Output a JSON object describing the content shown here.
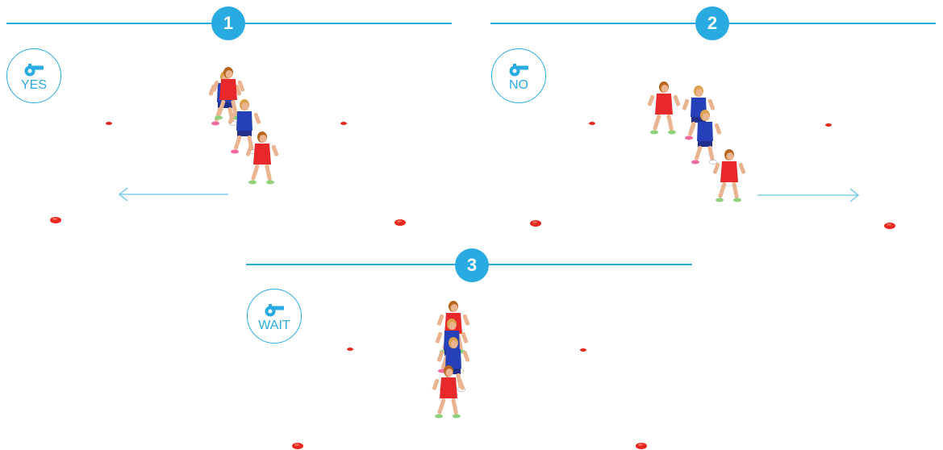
{
  "steps": [
    {
      "number": "1",
      "call": "YES"
    },
    {
      "number": "2",
      "call": "NO"
    },
    {
      "number": "3",
      "call": "WAIT"
    }
  ],
  "colors": {
    "accent": "#29abe2",
    "cone": "#e8281e",
    "shirt_red": "#e8282a",
    "shirt_blue": "#2540b8",
    "skin": "#e9b48f"
  },
  "icons": [
    "whistle-icon",
    "arrow-left-icon",
    "arrow-right-icon",
    "cone-marker",
    "player-figure"
  ]
}
